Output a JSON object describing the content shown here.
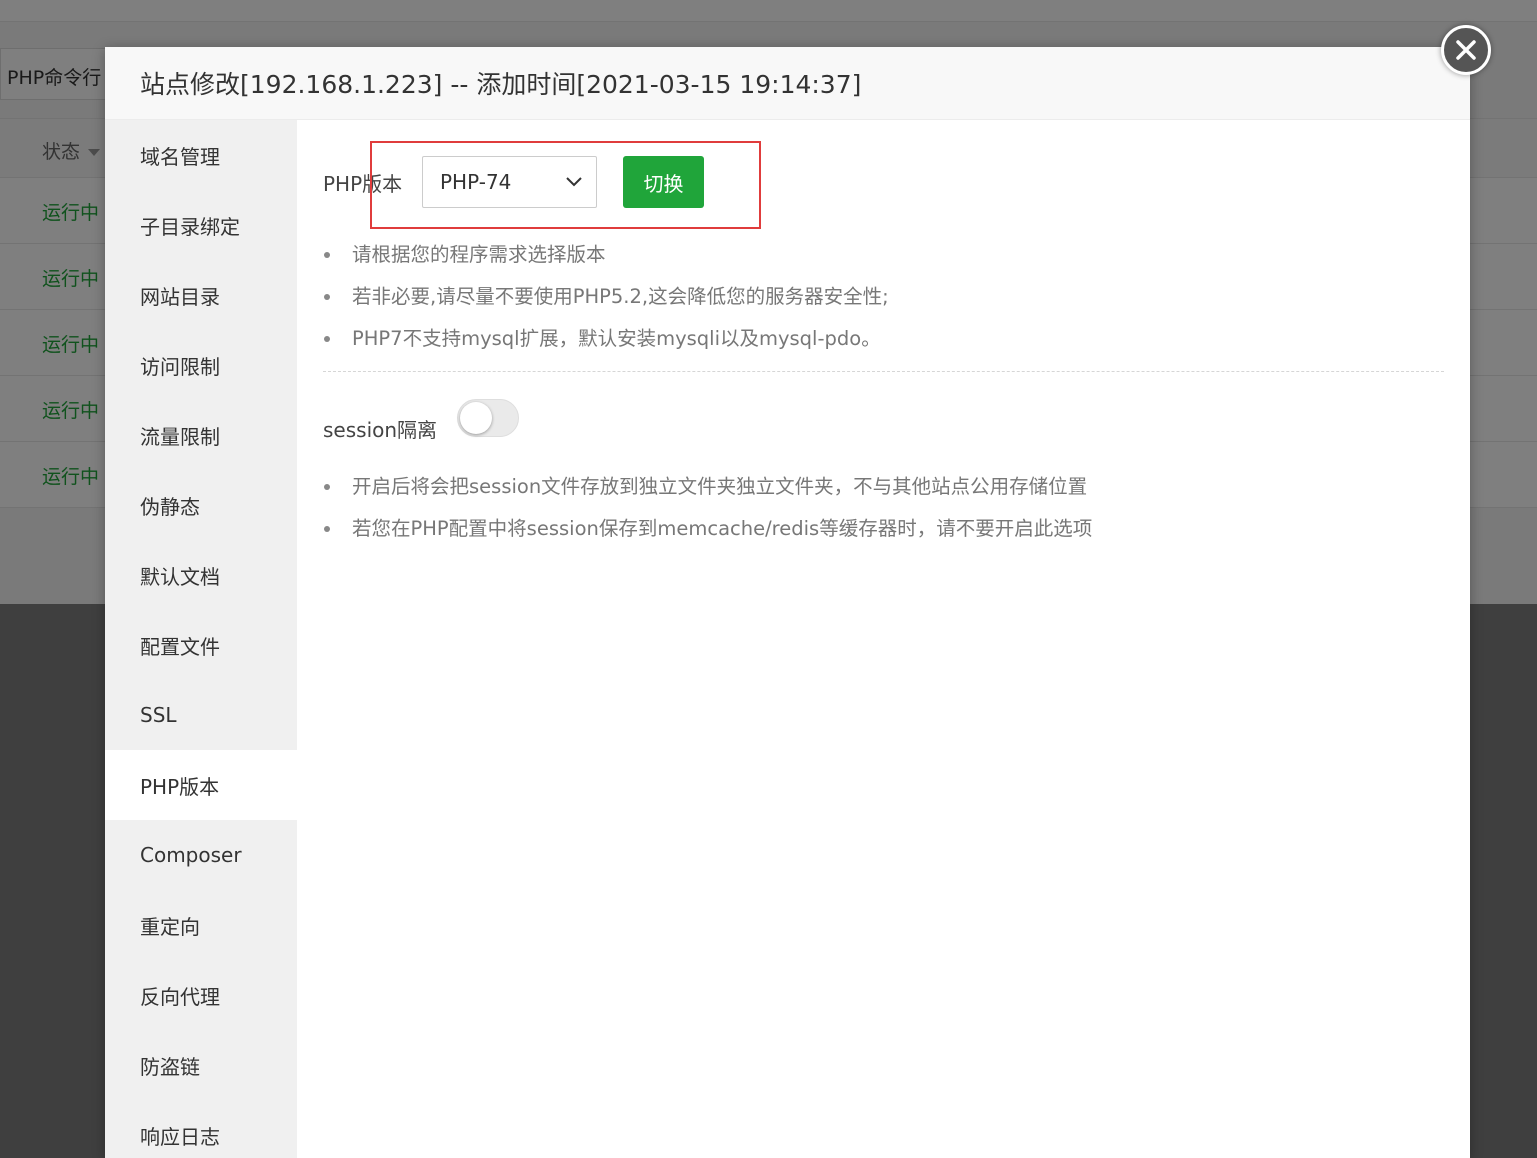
{
  "background": {
    "php_cli_label": "PHP命令行",
    "status_header": "状态",
    "rows": [
      "运行中",
      "运行中",
      "运行中",
      "运行中",
      "运行中"
    ]
  },
  "modal": {
    "title": "站点修改[192.168.1.223] -- 添加时间[2021-03-15 19:14:37]",
    "sidebar": [
      {
        "label": "域名管理",
        "active": false
      },
      {
        "label": "子目录绑定",
        "active": false
      },
      {
        "label": "网站目录",
        "active": false
      },
      {
        "label": "访问限制",
        "active": false
      },
      {
        "label": "流量限制",
        "active": false
      },
      {
        "label": "伪静态",
        "active": false
      },
      {
        "label": "默认文档",
        "active": false
      },
      {
        "label": "配置文件",
        "active": false
      },
      {
        "label": "SSL",
        "active": false
      },
      {
        "label": "PHP版本",
        "active": true
      },
      {
        "label": "Composer",
        "active": false
      },
      {
        "label": "重定向",
        "active": false
      },
      {
        "label": "反向代理",
        "active": false
      },
      {
        "label": "防盗链",
        "active": false
      },
      {
        "label": "响应日志",
        "active": false
      }
    ],
    "php": {
      "label": "PHP版本",
      "selected": "PHP-74",
      "switch_label": "切换",
      "tips": [
        "请根据您的程序需求选择版本",
        "若非必要,请尽量不要使用PHP5.2,这会降低您的服务器安全性;",
        "PHP7不支持mysql扩展，默认安装mysqli以及mysql-pdo。"
      ]
    },
    "session": {
      "label": "session隔离",
      "enabled": false,
      "tips": [
        "开启后将会把session文件存放到独立文件夹独立文件夹，不与其他站点公用存储位置",
        "若您在PHP配置中将session保存到memcache/redis等缓存器时，请不要开启此选项"
      ]
    }
  },
  "colors": {
    "accent_green": "#20a53a",
    "highlight_red": "#e03c3c"
  }
}
